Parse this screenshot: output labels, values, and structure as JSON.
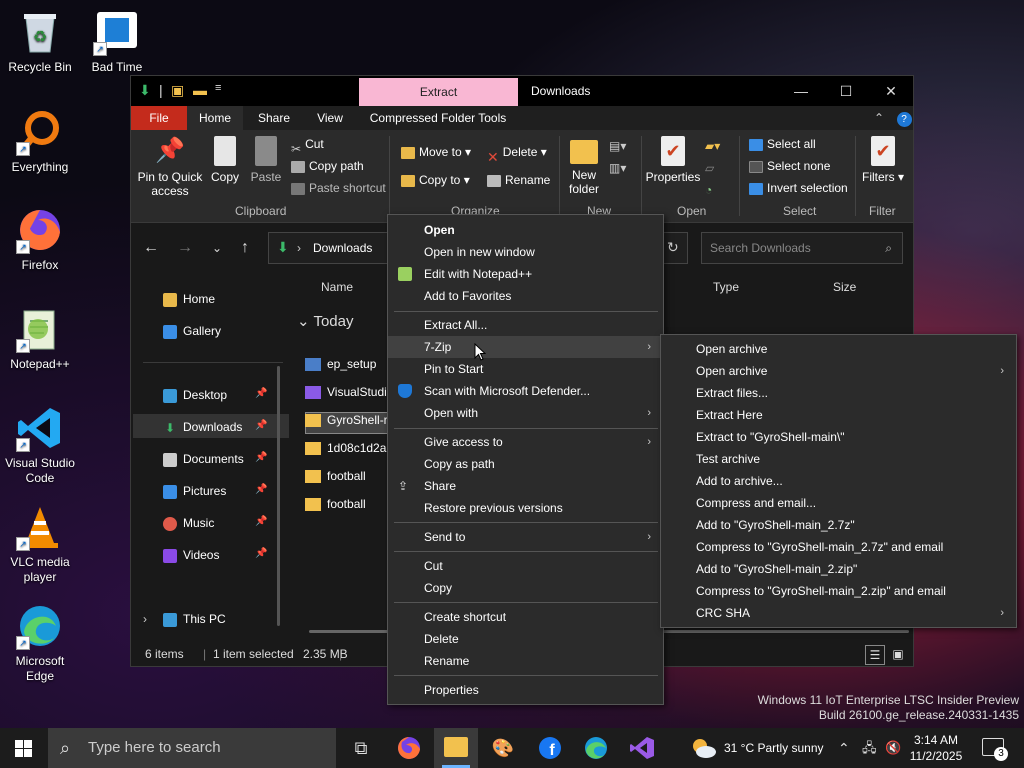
{
  "desktop": {
    "icons": [
      {
        "label": "Recycle Bin"
      },
      {
        "label": "Bad Time"
      },
      {
        "label": "Everything"
      },
      {
        "label": "Firefox"
      },
      {
        "label": "Notepad++"
      },
      {
        "label": "Visual Studio Code"
      },
      {
        "label": "VLC media player"
      },
      {
        "label": "Microsoft Edge"
      }
    ]
  },
  "window": {
    "contextual_tab": "Extract",
    "title": "Downloads",
    "tabs": [
      "File",
      "Home",
      "Share",
      "View",
      "Compressed Folder Tools"
    ],
    "ribbon": {
      "pin_quick_access": "Pin to Quick access",
      "copy": "Copy",
      "paste": "Paste",
      "cut": "Cut",
      "copy_path": "Copy path",
      "paste_shortcut": "Paste shortcut",
      "move_to": "Move to",
      "copy_to": "Copy to",
      "delete": "Delete",
      "rename": "Rename",
      "new_folder": "New folder",
      "properties": "Properties",
      "select_all": "Select all",
      "select_none": "Select none",
      "invert_selection": "Invert selection",
      "filters": "Filters",
      "groups": {
        "clipboard": "Clipboard",
        "organize": "Organize",
        "new": "New",
        "open": "Open",
        "select": "Select",
        "filter": "Filter"
      }
    },
    "address": "Downloads",
    "search_placeholder": "Search Downloads",
    "nav": [
      "Home",
      "Gallery",
      "Desktop",
      "Downloads",
      "Documents",
      "Pictures",
      "Music",
      "Videos",
      "This PC"
    ],
    "columns": [
      "Name",
      "Type",
      "Size"
    ],
    "group_header": "Today",
    "files": [
      "ep_setup",
      "VisualStudi",
      "GyroShell-r",
      "1d08c1d2a7",
      "football",
      "football"
    ],
    "status": {
      "items": "6 items",
      "selected": "1 item selected",
      "size": "2.35 MB"
    }
  },
  "context_menu": {
    "items": [
      "Open",
      "Open in new window",
      "Edit with Notepad++",
      "Add to Favorites",
      "Extract All...",
      "7-Zip",
      "Pin to Start",
      "Scan with Microsoft Defender...",
      "Open with",
      "Give access to",
      "Copy as path",
      "Share",
      "Restore previous versions",
      "Send to",
      "Cut",
      "Copy",
      "Create shortcut",
      "Delete",
      "Rename",
      "Properties"
    ]
  },
  "submenu_7zip": {
    "items": [
      "Open archive",
      "Open archive",
      "Extract files...",
      "Extract Here",
      "Extract to \"GyroShell-main\\\"",
      "Test archive",
      "Add to archive...",
      "Compress and email...",
      "Add to \"GyroShell-main_2.7z\"",
      "Compress to \"GyroShell-main_2.7z\" and email",
      "Add to \"GyroShell-main_2.zip\"",
      "Compress to \"GyroShell-main_2.zip\" and email",
      "CRC SHA"
    ]
  },
  "watermark": {
    "line1": "Windows 11 IoT Enterprise LTSC Insider Preview",
    "line2": "Build 26100.ge_release.240331-1435"
  },
  "taskbar": {
    "search_placeholder": "Type here to search",
    "weather": "31 °C  Partly sunny",
    "time": "3:14 AM",
    "date": "11/2/2025",
    "notification_count": "3"
  }
}
